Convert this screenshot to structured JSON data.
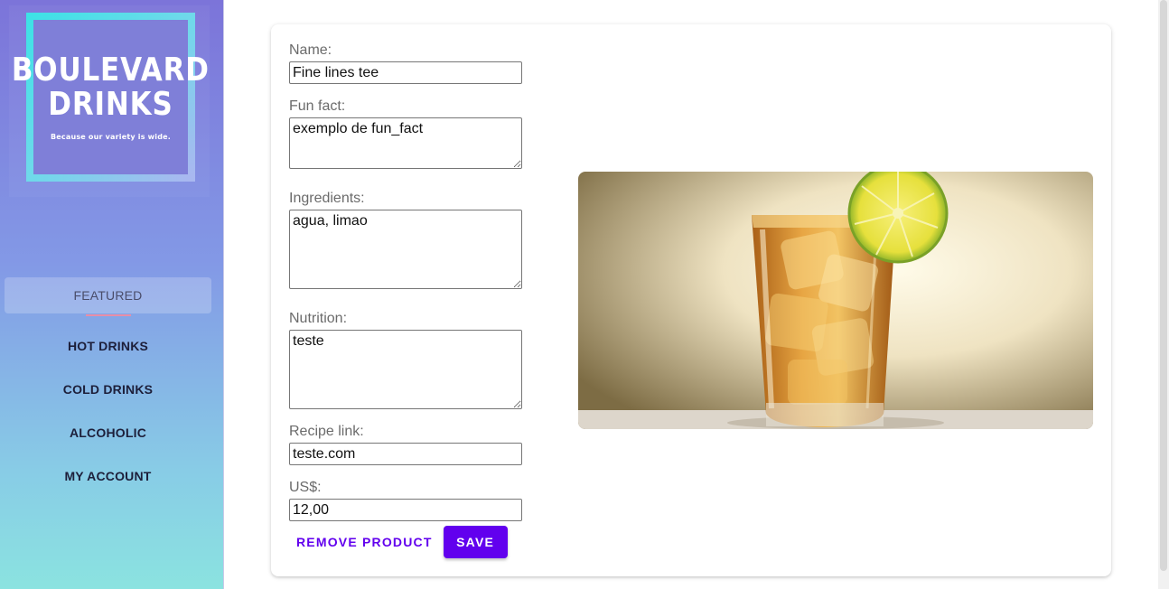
{
  "sidebar": {
    "logo": {
      "line1": "BOULEVARD",
      "line2": "DRINKS",
      "tagline": "Because our variety is wide."
    },
    "nav": [
      {
        "label": "FEATURED"
      },
      {
        "label": "HOT DRINKS"
      },
      {
        "label": "COLD DRINKS"
      },
      {
        "label": "ALCOHOLIC"
      },
      {
        "label": "MY ACCOUNT"
      }
    ]
  },
  "form": {
    "name": {
      "label": "Name:",
      "value": "Fine lines tee"
    },
    "fun_fact": {
      "label": "Fun fact:",
      "value": "exemplo de fun_fact"
    },
    "ingredients": {
      "label": "Ingredients:",
      "value": "agua, limao"
    },
    "nutrition": {
      "label": "Nutrition:",
      "value": "teste"
    },
    "recipe_link": {
      "label": "Recipe link:",
      "value": "teste.com"
    },
    "price": {
      "label": "US$:",
      "value": "12,00"
    }
  },
  "actions": {
    "remove_label": "REMOVE PRODUCT",
    "save_label": "SAVE"
  },
  "colors": {
    "accent": "#6200ee",
    "sidebar_top": "#7c74d9",
    "sidebar_bottom": "#8be3e0"
  },
  "icons": {
    "product_image": "iced-tea-glass-with-lemon"
  }
}
